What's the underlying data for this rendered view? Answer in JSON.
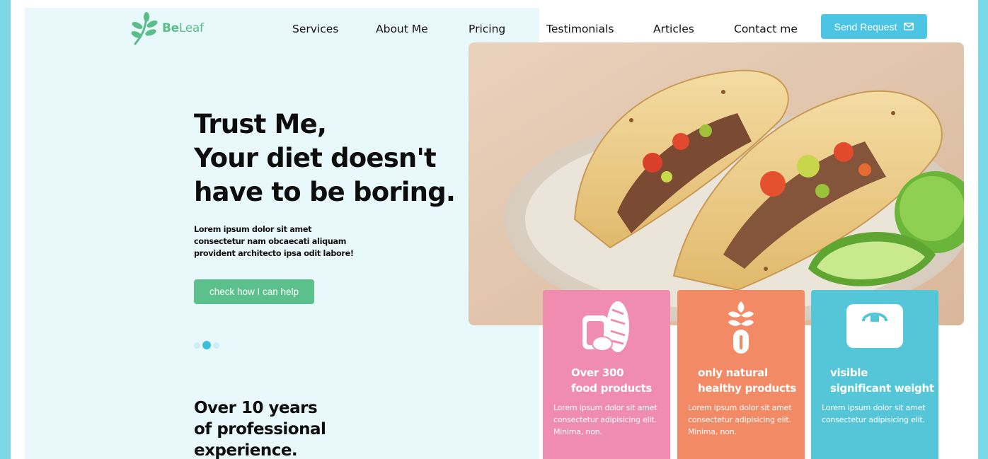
{
  "brand": {
    "name_part1": "Be",
    "name_part2": "Leaf",
    "color": "#5bbd8a"
  },
  "nav": {
    "items": [
      "Services",
      "About Me",
      "Pricing",
      "Testimonials",
      "Articles",
      "Contact me"
    ],
    "send_request": "Send Request",
    "send_icon": "envelope-icon",
    "accent": "#4cc4e4"
  },
  "hero": {
    "title_lines": [
      "Trust Me,",
      "Your diet doesn't",
      "have to be boring."
    ],
    "text": "Lorem ipsum dolor sit amet consectetur nam obcaecati aliquam provident architecto ipsa odit labore!",
    "cta": "check how I can help",
    "cta_color": "#5cc08c",
    "carousel_dots": 3,
    "carousel_active": 2
  },
  "experience": {
    "title_lines": [
      "Over 10 years",
      "of professional",
      "experience."
    ]
  },
  "features": [
    {
      "icon": "bread-icon",
      "title_lines": [
        "Over 300",
        "food products"
      ],
      "text": "Lorem ipsum dolor sit amet consectetur adipisicing elit. Minima, non.",
      "color": "#ef8cb0"
    },
    {
      "icon": "plant-test-tube-icon",
      "title_lines": [
        "only natural",
        "healthy products"
      ],
      "text": "Lorem ipsum dolor sit amet consectetur adipisicing elit. Minima, non.",
      "color": "#f28a66"
    },
    {
      "icon": "scale-icon",
      "title_lines": [
        "visible",
        "significant weight"
      ],
      "text": "Lorem ipsum dolor sit amet consectetur adipisicing elit.",
      "color": "#54c6d8"
    }
  ]
}
